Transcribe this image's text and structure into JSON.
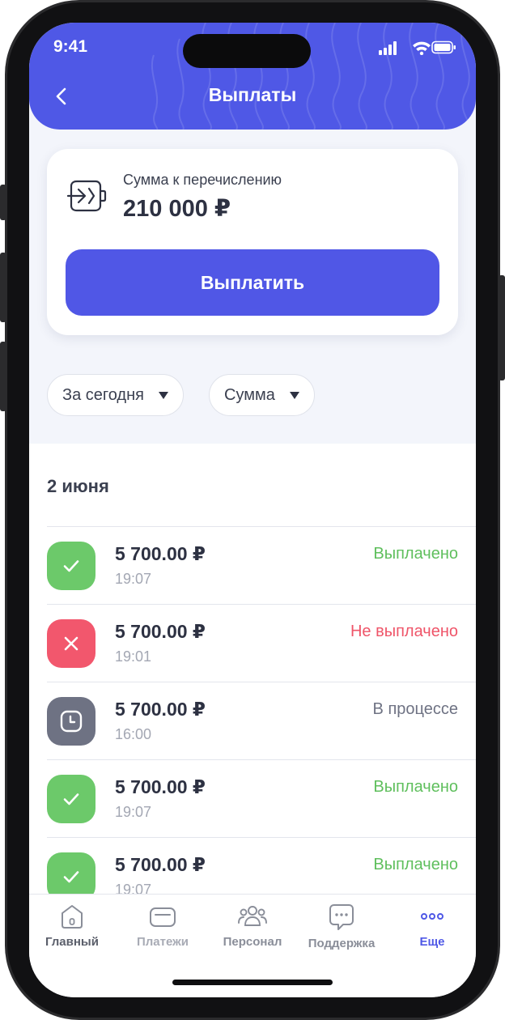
{
  "status_bar": {
    "time": "9:41"
  },
  "header": {
    "title": "Выплаты"
  },
  "summary": {
    "label": "Сумма к перечислению",
    "amount": "210 000 ₽",
    "button_label": "Выплатить"
  },
  "filters": [
    {
      "label": "За сегодня"
    },
    {
      "label": "Сумма"
    }
  ],
  "group": {
    "date": "2 июня"
  },
  "payouts": [
    {
      "amount": "5 700.00 ₽",
      "time": "19:07",
      "status": "Выплачено",
      "state": "success"
    },
    {
      "amount": "5 700.00 ₽",
      "time": "19:01",
      "status": "Не выплачено",
      "state": "failed"
    },
    {
      "amount": "5 700.00 ₽",
      "time": "16:00",
      "status": "В процессе",
      "state": "pending"
    },
    {
      "amount": "5 700.00 ₽",
      "time": "19:07",
      "status": "Выплачено",
      "state": "success"
    },
    {
      "amount": "5 700.00 ₽",
      "time": "19:07",
      "status": "Выплачено",
      "state": "success"
    }
  ],
  "tabbar": {
    "items": [
      {
        "label": "Главный",
        "icon": "home-icon"
      },
      {
        "label": "Платежи",
        "icon": "wallet-icon"
      },
      {
        "label": "Персонал",
        "icon": "people-icon"
      },
      {
        "label": "Поддержка",
        "icon": "chat-icon"
      },
      {
        "label": "Еще",
        "icon": "more-dots-icon",
        "active": true
      }
    ]
  },
  "colors": {
    "accent": "#5057e6",
    "success": "#6cc96a",
    "failed": "#f2576d",
    "pending": "#6e7283",
    "success_text": "#5fbf5d",
    "failed_text": "#ef5569",
    "pending_text": "#6e7283"
  }
}
